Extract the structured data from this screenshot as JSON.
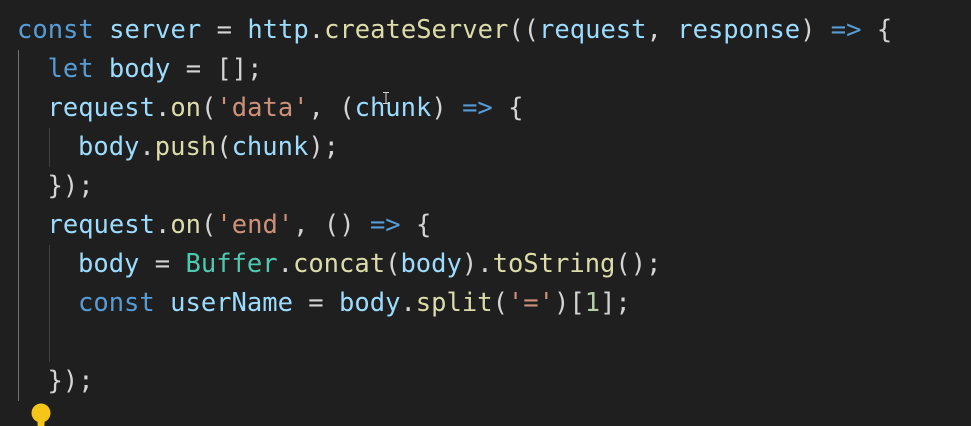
{
  "editor": {
    "colors": {
      "background": "#1f1f1f",
      "keyword": "#569cd6",
      "variable": "#9cdcfe",
      "function": "#dcdcaa",
      "string": "#ce9178",
      "number": "#b5cea8",
      "class": "#4ec9b0",
      "punctuation": "#d4d4d4",
      "lightbulb": "#f5c518"
    },
    "lines": [
      {
        "indent": 0,
        "tokens": [
          {
            "t": "const",
            "c": "keyword"
          },
          {
            "t": " ",
            "c": "punctuation"
          },
          {
            "t": "server",
            "c": "variable"
          },
          {
            "t": " = ",
            "c": "punctuation"
          },
          {
            "t": "http",
            "c": "variable"
          },
          {
            "t": ".",
            "c": "punctuation"
          },
          {
            "t": "createServer",
            "c": "function"
          },
          {
            "t": "((",
            "c": "punctuation"
          },
          {
            "t": "request",
            "c": "variable"
          },
          {
            "t": ", ",
            "c": "punctuation"
          },
          {
            "t": "response",
            "c": "variable"
          },
          {
            "t": ") ",
            "c": "punctuation"
          },
          {
            "t": "=>",
            "c": "keyword"
          },
          {
            "t": " {",
            "c": "punctuation"
          }
        ]
      },
      {
        "indent": 1,
        "tokens": [
          {
            "t": "let",
            "c": "keyword"
          },
          {
            "t": " ",
            "c": "punctuation"
          },
          {
            "t": "body",
            "c": "variable"
          },
          {
            "t": " = [];",
            "c": "punctuation"
          }
        ]
      },
      {
        "indent": 1,
        "tokens": [
          {
            "t": "request",
            "c": "variable"
          },
          {
            "t": ".",
            "c": "punctuation"
          },
          {
            "t": "on",
            "c": "function"
          },
          {
            "t": "(",
            "c": "punctuation"
          },
          {
            "t": "'data'",
            "c": "string"
          },
          {
            "t": ", (",
            "c": "punctuation"
          },
          {
            "t": "chunk",
            "c": "variable"
          },
          {
            "t": ") ",
            "c": "punctuation"
          },
          {
            "t": "=>",
            "c": "keyword"
          },
          {
            "t": " {",
            "c": "punctuation"
          }
        ]
      },
      {
        "indent": 2,
        "tokens": [
          {
            "t": "body",
            "c": "variable"
          },
          {
            "t": ".",
            "c": "punctuation"
          },
          {
            "t": "push",
            "c": "function"
          },
          {
            "t": "(",
            "c": "punctuation"
          },
          {
            "t": "chunk",
            "c": "variable"
          },
          {
            "t": ");",
            "c": "punctuation"
          }
        ]
      },
      {
        "indent": 1,
        "tokens": [
          {
            "t": "});",
            "c": "punctuation"
          }
        ]
      },
      {
        "indent": 1,
        "tokens": [
          {
            "t": "request",
            "c": "variable"
          },
          {
            "t": ".",
            "c": "punctuation"
          },
          {
            "t": "on",
            "c": "function"
          },
          {
            "t": "(",
            "c": "punctuation"
          },
          {
            "t": "'end'",
            "c": "string"
          },
          {
            "t": ", () ",
            "c": "punctuation"
          },
          {
            "t": "=>",
            "c": "keyword"
          },
          {
            "t": " {",
            "c": "punctuation"
          }
        ]
      },
      {
        "indent": 2,
        "tokens": [
          {
            "t": "body",
            "c": "variable"
          },
          {
            "t": " = ",
            "c": "punctuation"
          },
          {
            "t": "Buffer",
            "c": "class"
          },
          {
            "t": ".",
            "c": "punctuation"
          },
          {
            "t": "concat",
            "c": "function"
          },
          {
            "t": "(",
            "c": "punctuation"
          },
          {
            "t": "body",
            "c": "variable"
          },
          {
            "t": ").",
            "c": "punctuation"
          },
          {
            "t": "toString",
            "c": "function"
          },
          {
            "t": "();",
            "c": "punctuation"
          }
        ]
      },
      {
        "indent": 2,
        "tokens": [
          {
            "t": "const",
            "c": "keyword"
          },
          {
            "t": " ",
            "c": "punctuation"
          },
          {
            "t": "userName",
            "c": "variable"
          },
          {
            "t": " = ",
            "c": "punctuation"
          },
          {
            "t": "body",
            "c": "variable"
          },
          {
            "t": ".",
            "c": "punctuation"
          },
          {
            "t": "split",
            "c": "function"
          },
          {
            "t": "(",
            "c": "punctuation"
          },
          {
            "t": "'='",
            "c": "string"
          },
          {
            "t": ")[",
            "c": "punctuation"
          },
          {
            "t": "1",
            "c": "number"
          },
          {
            "t": "];",
            "c": "punctuation"
          }
        ]
      },
      {
        "indent": 2,
        "tokens": []
      },
      {
        "indent": 1,
        "tokens": [
          {
            "t": "});",
            "c": "punctuation"
          }
        ]
      }
    ],
    "lightbulb_icon": "lightbulb-icon",
    "cursor_icon": "text-cursor-icon"
  }
}
